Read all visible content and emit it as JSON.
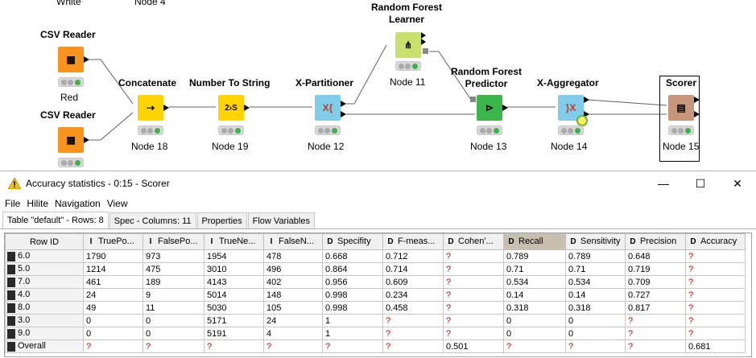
{
  "workflow": {
    "partial_labels": [
      "White",
      "Node 4"
    ],
    "nodes": [
      {
        "title": "CSV Reader",
        "name": "Red",
        "color": "#f7941d",
        "glyph": "▦"
      },
      {
        "title": "CSV Reader",
        "name": "",
        "color": "#f7941d",
        "glyph": "▦"
      },
      {
        "title": "Concatenate",
        "name": "Node 18",
        "color": "#ffd400",
        "glyph": "⇢"
      },
      {
        "title": "Number To String",
        "name": "Node 19",
        "color": "#ffd400",
        "glyph": "2›S"
      },
      {
        "title": "X-Partitioner",
        "name": "Node 12",
        "color": "#7fcde8",
        "glyph": "X{"
      },
      {
        "title": "Random Forest Learner",
        "name": "Node 11",
        "color": "#c8e06c",
        "glyph": "⋔"
      },
      {
        "title": "Random Forest Predictor",
        "name": "Node 13",
        "color": "#3cb54a",
        "glyph": "⊳"
      },
      {
        "title": "X-Aggregator",
        "name": "Node 14",
        "color": "#7fcde8",
        "glyph": "}X"
      },
      {
        "title": "Scorer",
        "name": "Node 15",
        "color": "#c8967a",
        "glyph": "▤"
      }
    ]
  },
  "dialog": {
    "title": "Accuracy statistics - 0:15 - Scorer",
    "window_buttons": [
      "—",
      "☐",
      "✕"
    ],
    "menu": [
      "File",
      "Hilite",
      "Navigation",
      "View"
    ],
    "tabs": [
      "Table \"default\" - Rows: 8",
      "Spec - Columns: 11",
      "Properties",
      "Flow Variables"
    ],
    "table": {
      "columns": [
        {
          "label": "Row ID",
          "type": ""
        },
        {
          "label": "TruePo...",
          "type": "I"
        },
        {
          "label": "FalsePo...",
          "type": "I"
        },
        {
          "label": "TrueNe...",
          "type": "I"
        },
        {
          "label": "FalseN...",
          "type": "I"
        },
        {
          "label": "Specifity",
          "type": "D"
        },
        {
          "label": "F-meas...",
          "type": "D"
        },
        {
          "label": "Cohen'...",
          "type": "D"
        },
        {
          "label": "Recall",
          "type": "D"
        },
        {
          "label": "Sensitivity",
          "type": "D"
        },
        {
          "label": "Precision",
          "type": "D"
        },
        {
          "label": "Accuracy",
          "type": "D"
        }
      ],
      "rows": [
        [
          "6.0",
          "1790",
          "973",
          "1954",
          "478",
          "0.668",
          "0.712",
          "?",
          "0.789",
          "0.789",
          "0.648",
          "?"
        ],
        [
          "5.0",
          "1214",
          "475",
          "3010",
          "496",
          "0.864",
          "0.714",
          "?",
          "0.71",
          "0.71",
          "0.719",
          "?"
        ],
        [
          "7.0",
          "461",
          "189",
          "4143",
          "402",
          "0.956",
          "0.609",
          "?",
          "0.534",
          "0.534",
          "0.709",
          "?"
        ],
        [
          "4.0",
          "24",
          "9",
          "5014",
          "148",
          "0.998",
          "0.234",
          "?",
          "0.14",
          "0.14",
          "0.727",
          "?"
        ],
        [
          "8.0",
          "49",
          "11",
          "5030",
          "105",
          "0.998",
          "0.458",
          "?",
          "0.318",
          "0.318",
          "0.817",
          "?"
        ],
        [
          "3.0",
          "0",
          "0",
          "5171",
          "24",
          "1",
          "?",
          "?",
          "0",
          "0",
          "?",
          "?"
        ],
        [
          "9.0",
          "0",
          "0",
          "5191",
          "4",
          "1",
          "?",
          "?",
          "0",
          "0",
          "?",
          "?"
        ],
        [
          "Overall",
          "?",
          "?",
          "?",
          "?",
          "?",
          "?",
          "0.501",
          "?",
          "?",
          "?",
          "0.681"
        ]
      ]
    }
  }
}
